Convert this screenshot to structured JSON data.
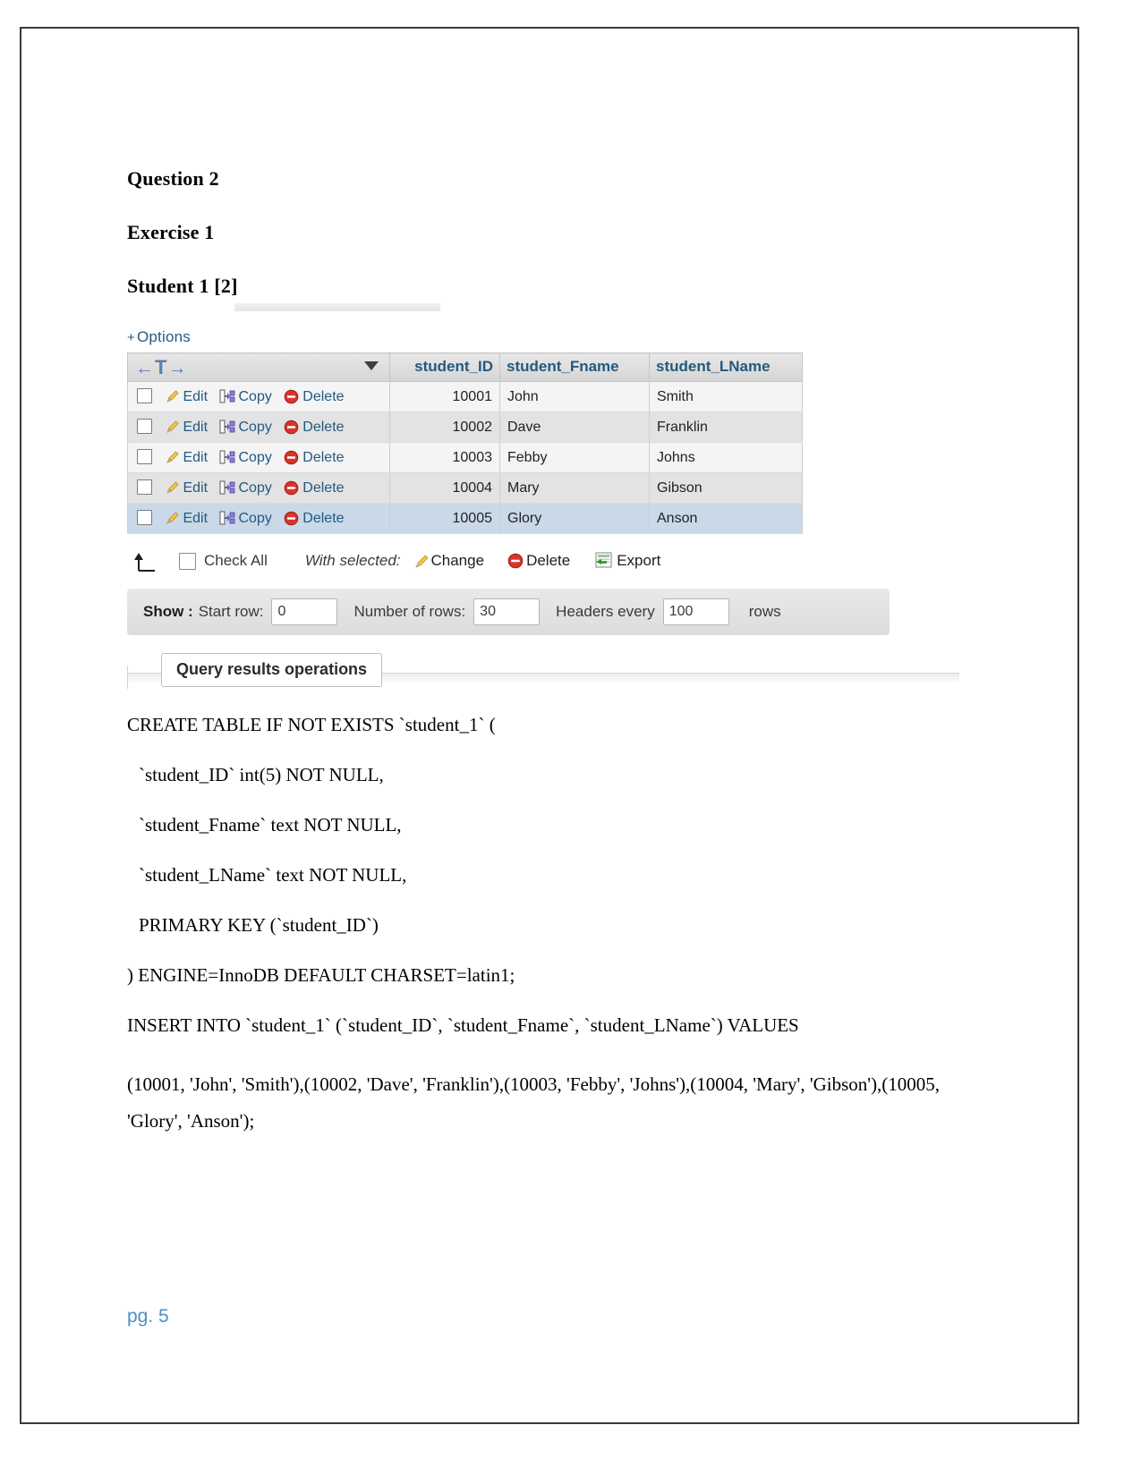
{
  "document": {
    "headings": [
      "Question 2",
      "Exercise 1",
      "Student 1 [2]"
    ],
    "footer": "pg. 5"
  },
  "phpmyadmin": {
    "options_label": "Options",
    "options_toggle": "+",
    "nav": {
      "left_arrow": "←",
      "t_glyph": "T",
      "right_arrow": "→"
    },
    "columns": [
      "student_ID",
      "student_Fname",
      "student_LName"
    ],
    "row_actions": {
      "edit": "Edit",
      "copy": "Copy",
      "delete": "Delete"
    },
    "rows": [
      {
        "student_ID": "10001",
        "student_Fname": "John",
        "student_LName": "Smith"
      },
      {
        "student_ID": "10002",
        "student_Fname": "Dave",
        "student_LName": "Franklin"
      },
      {
        "student_ID": "10003",
        "student_Fname": "Febby",
        "student_LName": "Johns"
      },
      {
        "student_ID": "10004",
        "student_Fname": "Mary",
        "student_LName": "Gibson"
      },
      {
        "student_ID": "10005",
        "student_Fname": "Glory",
        "student_LName": "Anson"
      }
    ],
    "selection_bar": {
      "check_all": "Check All",
      "with_selected": "With selected:",
      "change": "Change",
      "delete": "Delete",
      "export": "Export"
    },
    "show_bar": {
      "show_label": "Show :",
      "start_row_label": "Start row:",
      "start_row_value": "0",
      "number_of_rows_label": "Number of rows:",
      "number_of_rows_value": "30",
      "headers_every_label": "Headers every",
      "headers_every_value": "100",
      "rows_label": "rows"
    },
    "query_results_operations": "Query results operations"
  },
  "sql": {
    "lines": [
      "CREATE TABLE IF NOT EXISTS `student_1` (",
      "`student_ID` int(5) NOT NULL,",
      "`student_Fname` text NOT NULL,",
      "`student_LName` text NOT NULL,",
      "PRIMARY KEY (`student_ID`)",
      ") ENGINE=InnoDB DEFAULT CHARSET=latin1;",
      "INSERT INTO `student_1` (`student_ID`, `student_Fname`, `student_LName`) VALUES",
      "(10001, 'John', 'Smith'),(10002, 'Dave', 'Franklin'),(10003, 'Febby', 'Johns'),(10004, 'Mary', 'Gibson'),(10005, 'Glory', 'Anson');"
    ]
  },
  "colors": {
    "link": "#235a81",
    "header_text": "#235a81",
    "footer": "#4d8fc4",
    "highlight_row": "#c9d9e8"
  }
}
